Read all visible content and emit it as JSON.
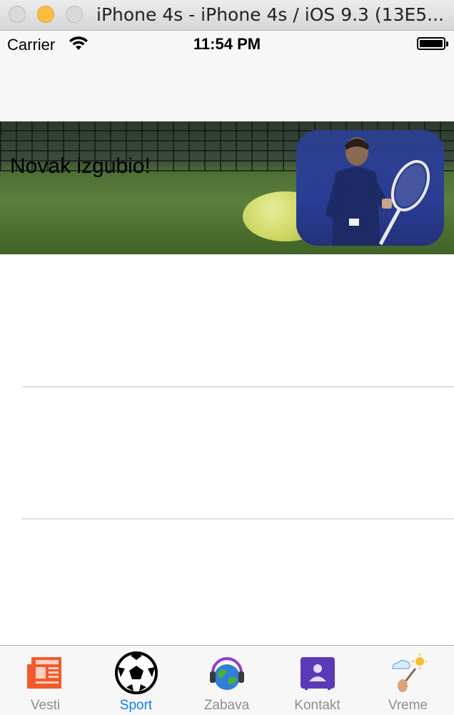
{
  "window": {
    "title": "iPhone 4s - iPhone 4s / iOS 9.3 (13E5..."
  },
  "status_bar": {
    "carrier": "Carrier",
    "time": "11:54 PM"
  },
  "news_cell": {
    "headline": "Novak izgubio!"
  },
  "tab_bar": {
    "items": [
      {
        "label": "Vesti",
        "icon": "newspaper-icon"
      },
      {
        "label": "Sport",
        "icon": "soccer-ball-icon"
      },
      {
        "label": "Zabava",
        "icon": "globe-headphones-icon"
      },
      {
        "label": "Kontakt",
        "icon": "contact-card-icon"
      },
      {
        "label": "Vreme",
        "icon": "weather-icon"
      }
    ],
    "selected": "Sport"
  },
  "colors": {
    "accent": "#0a7cff",
    "tab_inactive": "#8e8e93"
  }
}
